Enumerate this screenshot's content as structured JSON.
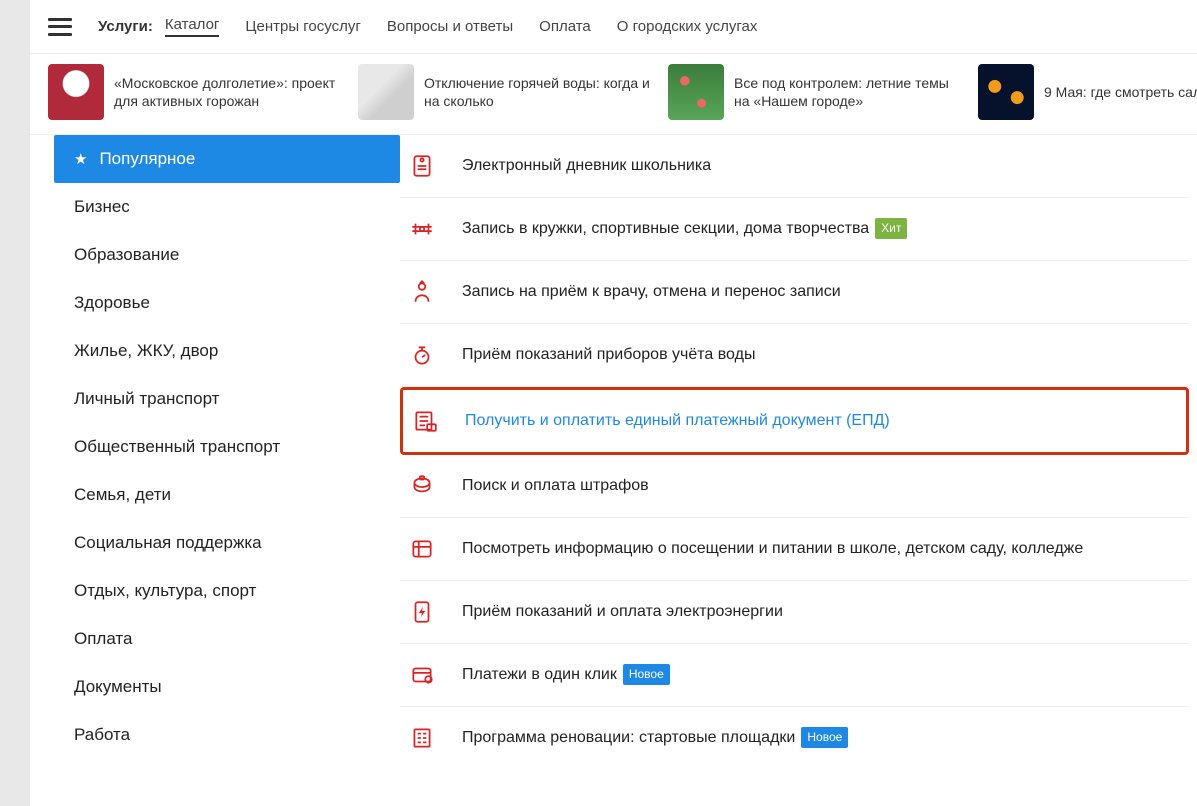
{
  "nav": {
    "label": "Услуги:",
    "items": [
      "Каталог",
      "Центры госуслуг",
      "Вопросы и ответы",
      "Оплата",
      "О городских услугах"
    ],
    "active_index": 0
  },
  "news": [
    {
      "text": "«Московское долголетие»: проект для активных горожан"
    },
    {
      "text": "Отключение горячей воды: когда и на сколько"
    },
    {
      "text": "Все под контролем: летние темы на «Нашем городе»"
    },
    {
      "text": "9 Мая: где смотреть сал"
    }
  ],
  "sidebar": [
    {
      "label": "Популярное",
      "active": true
    },
    {
      "label": "Бизнес"
    },
    {
      "label": "Образование"
    },
    {
      "label": "Здоровье"
    },
    {
      "label": "Жилье, ЖКУ, двор"
    },
    {
      "label": "Личный транспорт"
    },
    {
      "label": "Общественный транспорт"
    },
    {
      "label": "Семья, дети"
    },
    {
      "label": "Социальная поддержка"
    },
    {
      "label": "Отдых, культура, спорт"
    },
    {
      "label": "Оплата"
    },
    {
      "label": "Документы"
    },
    {
      "label": "Работа"
    }
  ],
  "services": [
    {
      "label": "Электронный дневник школьника",
      "icon": "school-dairy-icon"
    },
    {
      "label": "Запись в кружки, спортивные секции, дома творчества",
      "badge": "Хит",
      "badge_type": "hit",
      "icon": "sport-icon"
    },
    {
      "label": "Запись на приём к врачу, отмена и перенос записи",
      "icon": "doctor-icon"
    },
    {
      "label": "Приём показаний приборов учёта воды",
      "icon": "water-meter-icon"
    },
    {
      "label": "Получить и оплатить единый платежный документ (ЕПД)",
      "highlight": true,
      "icon": "payment-doc-icon"
    },
    {
      "label": "Поиск и оплата штрафов",
      "icon": "fines-icon"
    },
    {
      "label": "Посмотреть информацию о посещении и питании в школе, детском саду, колледже",
      "icon": "attendance-icon"
    },
    {
      "label": "Приём показаний и оплата электроэнергии",
      "icon": "electricity-icon"
    },
    {
      "label": "Платежи в один клик",
      "badge": "Новое",
      "badge_type": "new",
      "icon": "one-click-icon"
    },
    {
      "label": "Программа реновации: стартовые площадки",
      "badge": "Новое",
      "badge_type": "new",
      "icon": "renovation-icon",
      "no_border": true
    }
  ]
}
